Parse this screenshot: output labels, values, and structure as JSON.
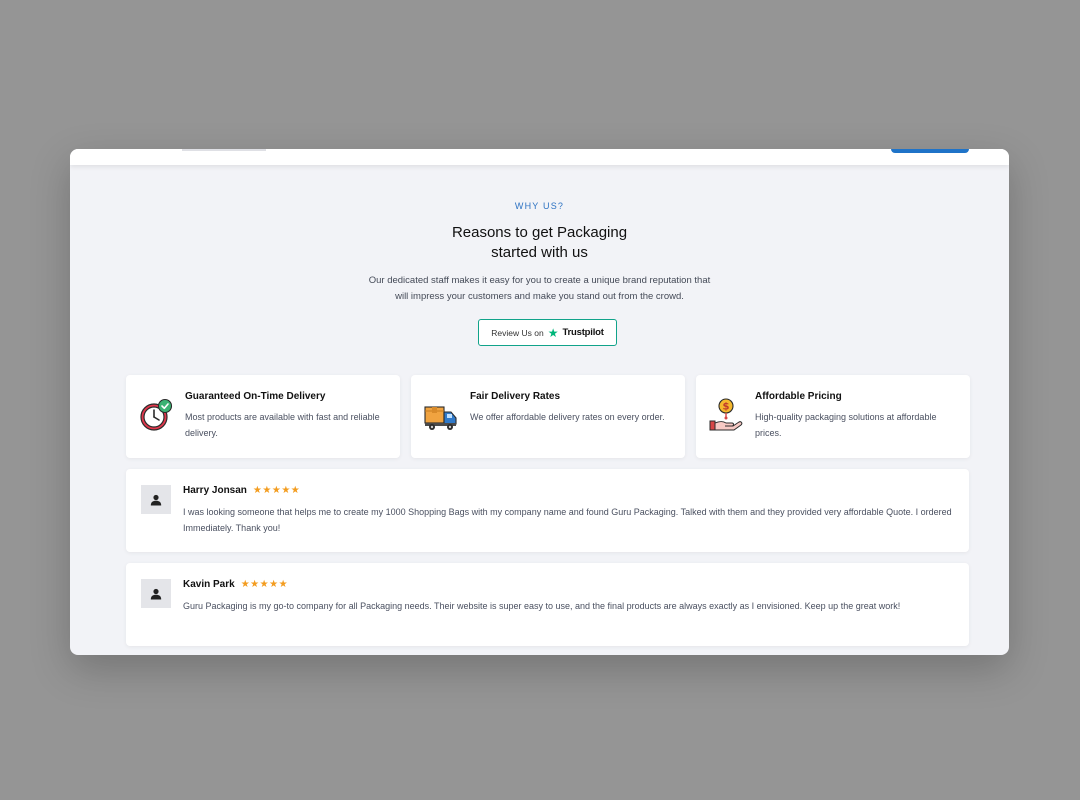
{
  "section": {
    "eyebrow": "WHY US?",
    "title_line1": "Reasons to get Packaging",
    "title_line2": "started with us",
    "description_line1": "Our dedicated staff makes it easy for you to create a unique brand reputation that",
    "description_line2": "will impress your customers and make you stand out from the crowd."
  },
  "review_button": {
    "label": "Review Us on",
    "brand": "Trustpilot",
    "accent": "#00b67a"
  },
  "features": [
    {
      "title": "Guaranteed On-Time Delivery",
      "description": "Most products are available with fast and reliable delivery.",
      "icon": "clock-check-icon"
    },
    {
      "title": "Fair Delivery Rates",
      "description": "We offer affordable delivery rates on every order.",
      "icon": "delivery-truck-icon"
    },
    {
      "title": "Affordable Pricing",
      "description": "High-quality packaging solutions at affordable prices.",
      "icon": "hand-coin-icon"
    }
  ],
  "reviews": [
    {
      "name": "Harry Jonsan",
      "stars": "★★★★★",
      "rating": 5,
      "text": "I was looking someone that helps me to create my 1000 Shopping Bags with my company name and found Guru Packaging. Talked with them and they provided very affordable Quote. I ordered Immediately. Thank you!"
    },
    {
      "name": "Kavin Park",
      "stars": "★★★★★",
      "rating": 5,
      "text": "Guru Packaging is my go-to company for all Packaging needs. Their website is super easy to use, and the final products are always exactly as I envisioned. Keep up the great work!"
    }
  ],
  "colors": {
    "page_background": "#f2f3f7",
    "accent_blue": "#2d72c2",
    "star_orange": "#f39c1f",
    "trustpilot_green": "#00b67a"
  }
}
